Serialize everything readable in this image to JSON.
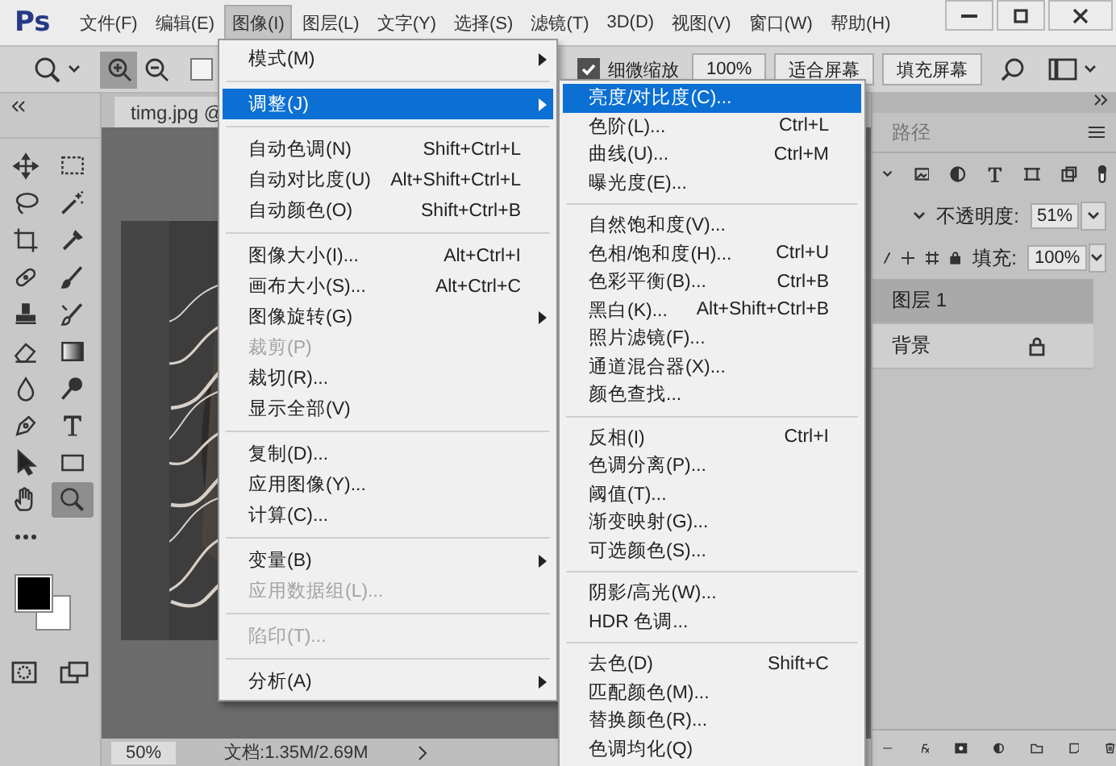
{
  "app": {
    "logo": "Ps"
  },
  "menu_bar": [
    {
      "label": "文件(F)",
      "selected": false
    },
    {
      "label": "编辑(E)",
      "selected": false
    },
    {
      "label": "图像(I)",
      "selected": true
    },
    {
      "label": "图层(L)",
      "selected": false
    },
    {
      "label": "文字(Y)",
      "selected": false
    },
    {
      "label": "选择(S)",
      "selected": false
    },
    {
      "label": "滤镜(T)",
      "selected": false
    },
    {
      "label": "3D(D)",
      "selected": false
    },
    {
      "label": "视图(V)",
      "selected": false
    },
    {
      "label": "窗口(W)",
      "selected": false
    },
    {
      "label": "帮助(H)",
      "selected": false
    }
  ],
  "options_bar": {
    "zoom_modes": [
      {
        "kind": "in",
        "selected": true
      },
      {
        "kind": "out",
        "selected": false
      }
    ],
    "left_checkbox": {
      "checked": false
    },
    "fine_zoom": {
      "label": "细微缩放",
      "checked": true
    },
    "buttons": [
      "100%",
      "适合屏幕",
      "填充屏幕"
    ]
  },
  "tools": [
    {
      "kind": "move",
      "selected": false
    },
    {
      "kind": "marquee",
      "selected": false
    },
    {
      "kind": "lasso",
      "selected": false
    },
    {
      "kind": "wand",
      "selected": false
    },
    {
      "kind": "crop",
      "selected": false
    },
    {
      "kind": "eyedropper",
      "selected": false
    },
    {
      "kind": "healing",
      "selected": false
    },
    {
      "kind": "brush",
      "selected": false
    },
    {
      "kind": "stamp",
      "selected": false
    },
    {
      "kind": "history",
      "selected": false
    },
    {
      "kind": "eraser",
      "selected": false
    },
    {
      "kind": "gradient",
      "selected": false
    },
    {
      "kind": "blur",
      "selected": false
    },
    {
      "kind": "dodge",
      "selected": false
    },
    {
      "kind": "pen",
      "selected": false
    },
    {
      "kind": "type",
      "selected": false
    },
    {
      "kind": "select",
      "selected": false
    },
    {
      "kind": "shape",
      "selected": false
    },
    {
      "kind": "hand",
      "selected": false
    },
    {
      "kind": "zoom",
      "selected": true
    },
    {
      "kind": "more",
      "selected": false
    }
  ],
  "document": {
    "tab": "timg.jpg @",
    "zoom": "50%",
    "info": "文档:1.35M/2.69M"
  },
  "layers_panel": {
    "tab": "路径",
    "opacity_label": "不透明度:",
    "opacity": "51%",
    "fill_label": "填充:",
    "fill": "100%",
    "layers": [
      {
        "name": "图层 1",
        "selected": true,
        "locked": false
      },
      {
        "name": "背景",
        "selected": false,
        "locked": true
      }
    ]
  },
  "image_menu": [
    {
      "kind": "item",
      "label": "模式(M)",
      "submenu": true,
      "selected": false,
      "disabled": false
    },
    {
      "kind": "separator"
    },
    {
      "kind": "item",
      "label": "调整(J)",
      "submenu": true,
      "selected": true,
      "disabled": false
    },
    {
      "kind": "separator"
    },
    {
      "kind": "item",
      "label": "自动色调(N)",
      "shortcut": "Shift+Ctrl+L",
      "submenu": false,
      "selected": false,
      "disabled": false
    },
    {
      "kind": "item",
      "label": "自动对比度(U)",
      "shortcut": "Alt+Shift+Ctrl+L",
      "submenu": false,
      "selected": false,
      "disabled": false
    },
    {
      "kind": "item",
      "label": "自动颜色(O)",
      "shortcut": "Shift+Ctrl+B",
      "submenu": false,
      "selected": false,
      "disabled": false
    },
    {
      "kind": "separator"
    },
    {
      "kind": "item",
      "label": "图像大小(I)...",
      "shortcut": "Alt+Ctrl+I",
      "submenu": false,
      "selected": false,
      "disabled": false
    },
    {
      "kind": "item",
      "label": "画布大小(S)...",
      "shortcut": "Alt+Ctrl+C",
      "submenu": false,
      "selected": false,
      "disabled": false
    },
    {
      "kind": "item",
      "label": "图像旋转(G)",
      "submenu": true,
      "selected": false,
      "disabled": false
    },
    {
      "kind": "item",
      "label": "裁剪(P)",
      "submenu": false,
      "selected": false,
      "disabled": true
    },
    {
      "kind": "item",
      "label": "裁切(R)...",
      "submenu": false,
      "selected": false,
      "disabled": false
    },
    {
      "kind": "item",
      "label": "显示全部(V)",
      "submenu": false,
      "selected": false,
      "disabled": false
    },
    {
      "kind": "separator"
    },
    {
      "kind": "item",
      "label": "复制(D)...",
      "submenu": false,
      "selected": false,
      "disabled": false
    },
    {
      "kind": "item",
      "label": "应用图像(Y)...",
      "submenu": false,
      "selected": false,
      "disabled": false
    },
    {
      "kind": "item",
      "label": "计算(C)...",
      "submenu": false,
      "selected": false,
      "disabled": false
    },
    {
      "kind": "separator"
    },
    {
      "kind": "item",
      "label": "变量(B)",
      "submenu": true,
      "selected": false,
      "disabled": false
    },
    {
      "kind": "item",
      "label": "应用数据组(L)...",
      "submenu": false,
      "selected": false,
      "disabled": true
    },
    {
      "kind": "separator"
    },
    {
      "kind": "item",
      "label": "陷印(T)...",
      "submenu": false,
      "selected": false,
      "disabled": true
    },
    {
      "kind": "separator"
    },
    {
      "kind": "item",
      "label": "分析(A)",
      "submenu": true,
      "selected": false,
      "disabled": false
    }
  ],
  "adjustments_menu": [
    {
      "kind": "item",
      "label": "亮度/对比度(C)...",
      "submenu": false,
      "selected": true,
      "disabled": false
    },
    {
      "kind": "item",
      "label": "色阶(L)...",
      "shortcut": "Ctrl+L",
      "submenu": false,
      "selected": false,
      "disabled": false
    },
    {
      "kind": "item",
      "label": "曲线(U)...",
      "shortcut": "Ctrl+M",
      "submenu": false,
      "selected": false,
      "disabled": false
    },
    {
      "kind": "item",
      "label": "曝光度(E)...",
      "submenu": false,
      "selected": false,
      "disabled": false
    },
    {
      "kind": "separator"
    },
    {
      "kind": "item",
      "label": "自然饱和度(V)...",
      "submenu": false,
      "selected": false,
      "disabled": false
    },
    {
      "kind": "item",
      "label": "色相/饱和度(H)...",
      "shortcut": "Ctrl+U",
      "submenu": false,
      "selected": false,
      "disabled": false
    },
    {
      "kind": "item",
      "label": "色彩平衡(B)...",
      "shortcut": "Ctrl+B",
      "submenu": false,
      "selected": false,
      "disabled": false
    },
    {
      "kind": "item",
      "label": "黑白(K)...",
      "shortcut": "Alt+Shift+Ctrl+B",
      "submenu": false,
      "selected": false,
      "disabled": false
    },
    {
      "kind": "item",
      "label": "照片滤镜(F)...",
      "submenu": false,
      "selected": false,
      "disabled": false
    },
    {
      "kind": "item",
      "label": "通道混合器(X)...",
      "submenu": false,
      "selected": false,
      "disabled": false
    },
    {
      "kind": "item",
      "label": "颜色查找...",
      "submenu": false,
      "selected": false,
      "disabled": false
    },
    {
      "kind": "separator"
    },
    {
      "kind": "item",
      "label": "反相(I)",
      "shortcut": "Ctrl+I",
      "submenu": false,
      "selected": false,
      "disabled": false
    },
    {
      "kind": "item",
      "label": "色调分离(P)...",
      "submenu": false,
      "selected": false,
      "disabled": false
    },
    {
      "kind": "item",
      "label": "阈值(T)...",
      "submenu": false,
      "selected": false,
      "disabled": false
    },
    {
      "kind": "item",
      "label": "渐变映射(G)...",
      "submenu": false,
      "selected": false,
      "disabled": false
    },
    {
      "kind": "item",
      "label": "可选颜色(S)...",
      "submenu": false,
      "selected": false,
      "disabled": false
    },
    {
      "kind": "separator"
    },
    {
      "kind": "item",
      "label": "阴影/高光(W)...",
      "submenu": false,
      "selected": false,
      "disabled": false
    },
    {
      "kind": "item",
      "label": "HDR 色调...",
      "submenu": false,
      "selected": false,
      "disabled": false
    },
    {
      "kind": "separator"
    },
    {
      "kind": "item",
      "label": "去色(D)",
      "shortcut": "Shift+C",
      "submenu": false,
      "selected": false,
      "disabled": false
    },
    {
      "kind": "item",
      "label": "匹配颜色(M)...",
      "submenu": false,
      "selected": false,
      "disabled": false
    },
    {
      "kind": "item",
      "label": "替换颜色(R)...",
      "submenu": false,
      "selected": false,
      "disabled": false
    },
    {
      "kind": "item",
      "label": "色调均化(Q)",
      "submenu": false,
      "selected": false,
      "disabled": false
    }
  ]
}
